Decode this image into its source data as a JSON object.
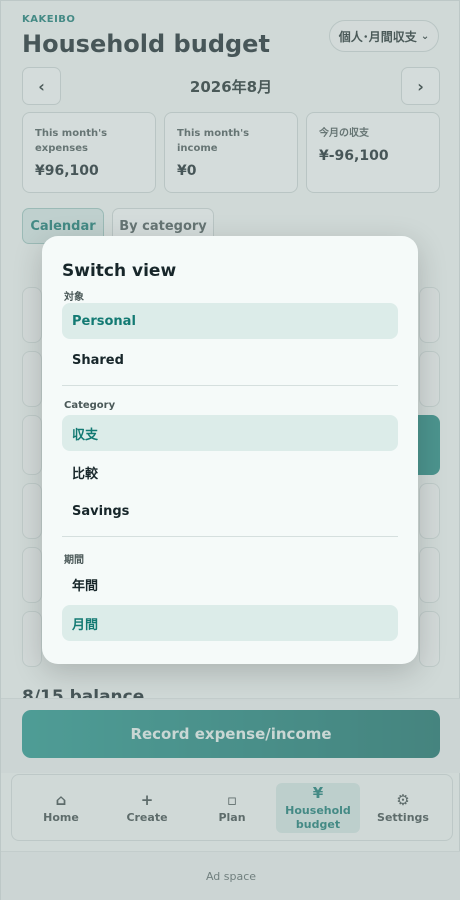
{
  "header": {
    "brand": "KAKEIBO",
    "title": "Household budget",
    "view_switch_label": "個人･月間収支",
    "view_switch_chevron": "⌄"
  },
  "month_nav": {
    "prev": "‹",
    "label": "2026年8月",
    "next": "›"
  },
  "summary": [
    {
      "label": "This month's expenses",
      "value": "¥96,100"
    },
    {
      "label": "This month's income",
      "value": "¥0"
    },
    {
      "label": "今月の収支",
      "value": "¥-96,100"
    }
  ],
  "tabs": [
    {
      "label": "Calendar",
      "selected": true
    },
    {
      "label": "By category",
      "selected": false
    }
  ],
  "background_caption": "8/15 balance",
  "record_button": "Record expense/income",
  "tabbar": [
    {
      "label": "Home",
      "icon": "home-icon",
      "glyph": "⌂"
    },
    {
      "label": "Create",
      "icon": "plus-icon",
      "glyph": "+"
    },
    {
      "label": "Plan",
      "icon": "square-icon",
      "glyph": "▫"
    },
    {
      "label": "Household budget",
      "icon": "yen-icon",
      "glyph": "¥",
      "active": true
    },
    {
      "label": "Settings",
      "icon": "gear-icon",
      "glyph": "⚙"
    }
  ],
  "ad_label": "Ad space",
  "modal": {
    "title": "Switch view",
    "sections": [
      {
        "label": "対象",
        "options": [
          {
            "label": "Personal",
            "selected": true
          },
          {
            "label": "Shared",
            "selected": false
          }
        ]
      },
      {
        "label": "Category",
        "options": [
          {
            "label": "収支",
            "selected": true
          },
          {
            "label": "比較",
            "selected": false
          },
          {
            "label": "Savings",
            "selected": false
          }
        ]
      },
      {
        "label": "期間",
        "options": [
          {
            "label": "年間",
            "selected": false
          },
          {
            "label": "月間",
            "selected": true
          }
        ]
      }
    ]
  },
  "colors": {
    "accent": "#137a73",
    "selected_bg": "#dcece9",
    "button_gradient_start": "#23978e",
    "button_gradient_end": "#147069"
  }
}
